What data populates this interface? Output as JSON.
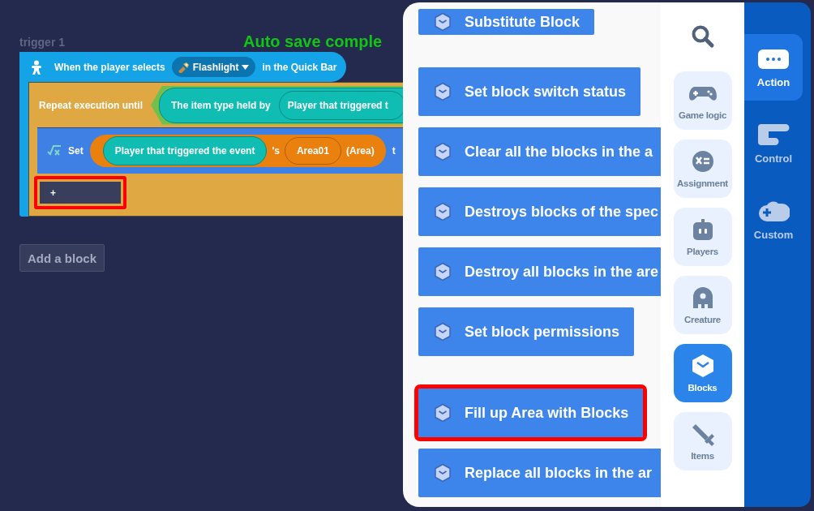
{
  "workspace": {
    "trigger_label": "trigger 1",
    "event": {
      "prefix": "When the player selects",
      "item": "Flashlight",
      "suffix": "in the Quick Bar"
    },
    "repeat": {
      "label": "Repeat execution until",
      "condition": "The item type held by",
      "condition_arg": "Player that triggered t"
    },
    "set": {
      "label": "Set",
      "target": "Player that triggered the event",
      "possessive": "'s",
      "property": "Area01",
      "type": "(Area)",
      "trailing": "t"
    },
    "slot": {
      "label": "+",
      "highlighted": true
    },
    "add_button": "Add a block",
    "toast": "Auto save comple"
  },
  "block_groups": [
    {
      "items": [
        {
          "label": "Substitute Block",
          "highlighted": false
        }
      ]
    },
    {
      "items": [
        {
          "label": "Set block switch status",
          "highlighted": false
        },
        {
          "label": "Clear all the blocks in the a",
          "highlighted": false
        },
        {
          "label": "Destroys blocks of the spec",
          "highlighted": false
        },
        {
          "label": "Destroy all blocks in the are",
          "highlighted": false
        },
        {
          "label": "Set block permissions",
          "highlighted": false
        }
      ]
    },
    {
      "items": [
        {
          "label": "Fill up Area with Blocks",
          "highlighted": true
        },
        {
          "label": "Replace all blocks in the ar",
          "highlighted": false
        }
      ]
    }
  ],
  "categories": [
    {
      "label": "Game logic",
      "kind": "gamepad",
      "selected": false
    },
    {
      "label": "Assignment",
      "kind": "assignment",
      "selected": false
    },
    {
      "label": "Players",
      "kind": "players",
      "selected": false
    },
    {
      "label": "Creature",
      "kind": "creature",
      "selected": false
    },
    {
      "label": "Blocks",
      "kind": "blocks",
      "selected": true
    },
    {
      "label": "Items",
      "kind": "items",
      "selected": false
    }
  ],
  "tabs": [
    {
      "label": "Action",
      "kind": "action",
      "selected": true
    },
    {
      "label": "Control",
      "kind": "control",
      "selected": false
    },
    {
      "label": "Custom",
      "kind": "custom",
      "selected": false
    }
  ]
}
